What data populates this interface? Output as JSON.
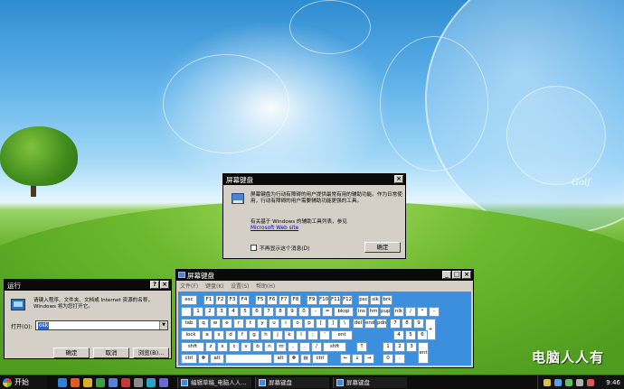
{
  "desktop": {
    "signature": "Golf",
    "watermark": "电脑人人有"
  },
  "popup": {
    "title": "屏幕键盘",
    "text": "屏幕键盘为行动有障碍的用户提供最常有用的辅助功能。作为日常使用，行动有障碍的用户需要辅助功能更强的工具。",
    "more_text": "有关基于 Windows 的辅助工具列表，参见",
    "link": "Microsoft Web site",
    "checkbox_label": "不再显示这个消息(D)",
    "ok_label": "确定"
  },
  "run": {
    "title": "运行",
    "help": "?",
    "close": "×",
    "desc": "请键入程序、文件夹、文档或 Internet 资源的名称，Windows 将为您打开它。",
    "open_label": "打开(O):",
    "input_value": "osk",
    "ok": "确定",
    "cancel": "取消",
    "browse": "浏览(B)..."
  },
  "osk": {
    "title": "屏幕键盘",
    "menu": [
      "文件(F)",
      "键盘(K)",
      "设置(S)",
      "帮助(H)"
    ],
    "keys": [
      [
        "esc",
        "F1",
        "F2",
        "F3",
        "F4",
        "F5",
        "F6",
        "F7",
        "F8",
        "F9",
        "F10",
        "F11",
        "F12",
        "psc",
        "slk",
        "brk"
      ],
      [
        "`",
        "1",
        "2",
        "3",
        "4",
        "5",
        "6",
        "7",
        "8",
        "9",
        "0",
        "-",
        "=",
        "bksp",
        "ins",
        "hm",
        "pup",
        "nlk",
        "/",
        "*",
        "-"
      ],
      [
        "tab",
        "q",
        "w",
        "e",
        "r",
        "t",
        "y",
        "u",
        "i",
        "o",
        "p",
        "[",
        "]",
        "\\",
        "del",
        "end",
        "pdn",
        "7",
        "8",
        "9",
        "+"
      ],
      [
        "lock",
        "a",
        "s",
        "d",
        "f",
        "g",
        "h",
        "j",
        "k",
        "l",
        ";",
        "'",
        "ent",
        "4",
        "5",
        "6"
      ],
      [
        "shft",
        "z",
        "x",
        "c",
        "v",
        "b",
        "n",
        "m",
        ",",
        ".",
        "/",
        "shft",
        "↑",
        "1",
        "2",
        "3",
        "ent"
      ],
      [
        "ctrl",
        "❖",
        "alt",
        "",
        "alt",
        "❖",
        "▤",
        "ctrl",
        "←",
        "↓",
        "→",
        "0",
        "."
      ]
    ]
  },
  "taskbar": {
    "start": "开始",
    "tasks": [
      "编辑草稿_电脑人人...",
      "屏幕键盘",
      "屏幕键盘"
    ],
    "clock": "9:46"
  }
}
